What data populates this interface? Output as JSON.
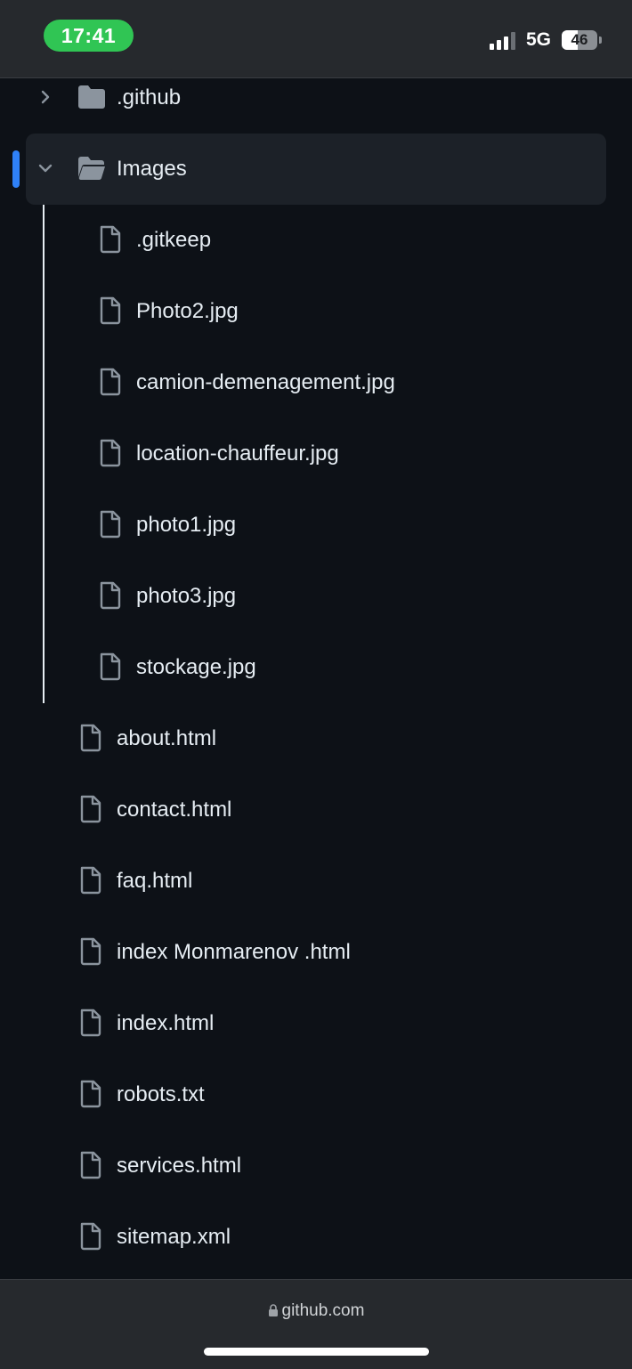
{
  "status_bar": {
    "time": "17:41",
    "network": "5G",
    "battery": "46",
    "battery_level": 0.46
  },
  "tree": {
    "top_items": [
      {
        "name": ".github",
        "type": "folder",
        "expanded": false
      }
    ],
    "selected_folder": {
      "name": "Images",
      "type": "folder",
      "expanded": true
    },
    "folder_children": [
      ".gitkeep",
      "Photo2.jpg",
      "camion-demenagement.jpg",
      "location-chauffeur.jpg",
      "photo1.jpg",
      "photo3.jpg",
      "stockage.jpg"
    ],
    "root_files": [
      "about.html",
      "contact.html",
      "faq.html",
      "index Monmarenov .html",
      "index.html",
      "robots.txt",
      "services.html",
      "sitemap.xml"
    ]
  },
  "browser": {
    "url": "github.com"
  },
  "colors": {
    "background": "#0d1117",
    "chrome": "#26292d",
    "accent": "#2f81f7",
    "time_pill": "#30c554",
    "icon": "#8b949e"
  }
}
